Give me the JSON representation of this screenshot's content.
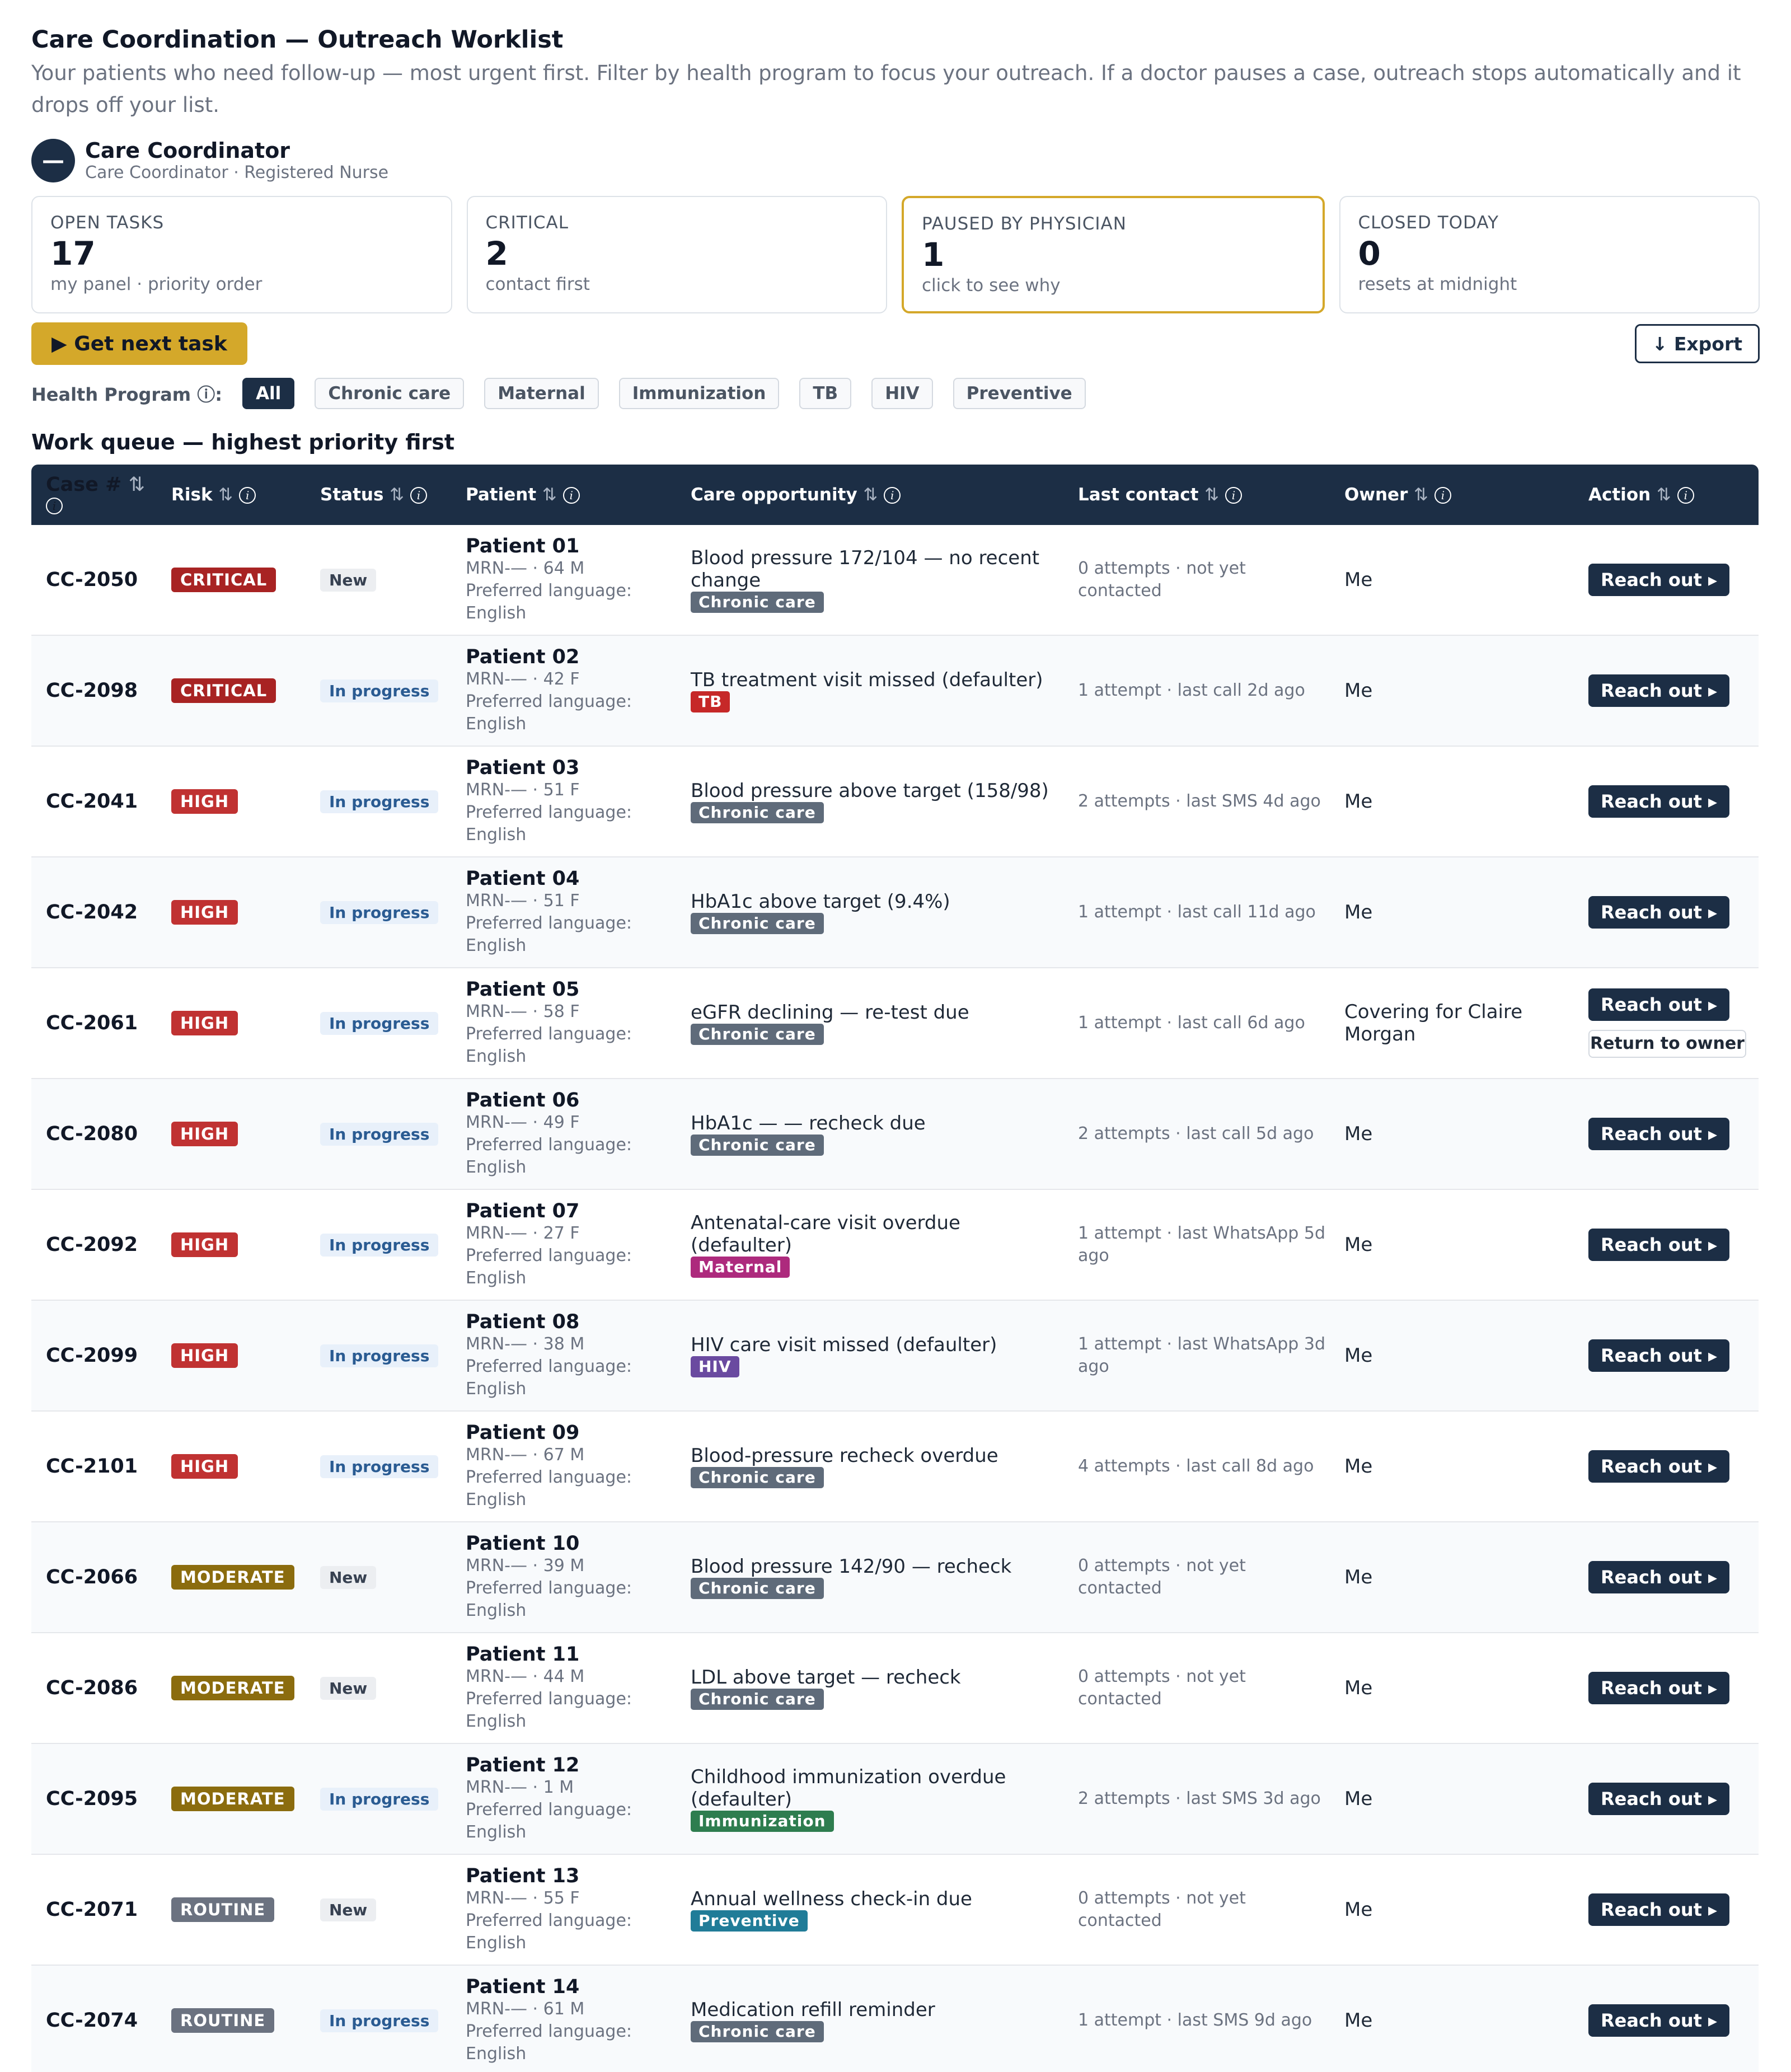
{
  "page": {
    "title": "Care Coordination — Outreach Worklist",
    "subtitle": "Your patients who need follow-up — most urgent first. Filter by health program to focus your outreach. If a doctor pauses a case, outreach stops automatically and it drops off your list."
  },
  "user": {
    "initial": "—",
    "name": "Care Coordinator",
    "role": "Care Coordinator · Registered Nurse"
  },
  "stats": [
    {
      "label": "OPEN TASKS",
      "value": "17",
      "note": "my panel · priority order"
    },
    {
      "label": "CRITICAL",
      "value": "2",
      "note": "contact first"
    },
    {
      "label": "PAUSED BY PHYSICIAN",
      "value": "1",
      "note": "click to see why"
    },
    {
      "label": "CLOSED TODAY",
      "value": "0",
      "note": "resets at midnight"
    }
  ],
  "actions": {
    "next_label": "▶ Get next task",
    "export_label": "↓ Export"
  },
  "filters": {
    "label": "Health Program ⓘ:",
    "chips": [
      "All",
      "Chronic care",
      "Maternal",
      "Immunization",
      "TB",
      "HIV",
      "Preventive"
    ],
    "active": "All"
  },
  "queue_title": "Work queue — highest priority first",
  "table": {
    "headers": [
      "Case #",
      "Risk",
      "Status",
      "Patient",
      "Care opportunity",
      "Last contact",
      "Owner",
      "Action"
    ],
    "sort_glyph": "⇅",
    "info_glyph": "i",
    "language_label": "Preferred language:",
    "reach_label": "Reach out ▸",
    "return_label": "Return to owner",
    "rows": [
      {
        "case": "CC-2050",
        "risk": "CRITICAL",
        "status": "New",
        "patient": "Patient 01",
        "meta": "MRN-— · 64 M",
        "language": "English",
        "opportunity": "Blood pressure 172/104 — no recent change",
        "program": "Chronic care",
        "last": "0 attempts · not yet contacted",
        "owner": "Me"
      },
      {
        "case": "CC-2098",
        "risk": "CRITICAL",
        "status": "In progress",
        "patient": "Patient 02",
        "meta": "MRN-— · 42 F",
        "language": "English",
        "opportunity": "TB treatment visit missed (defaulter)",
        "program": "TB",
        "last": "1 attempt · last call 2d ago",
        "owner": "Me"
      },
      {
        "case": "CC-2041",
        "risk": "HIGH",
        "status": "In progress",
        "patient": "Patient 03",
        "meta": "MRN-— · 51 F",
        "language": "English",
        "opportunity": "Blood pressure above target (158/98)",
        "program": "Chronic care",
        "last": "2 attempts · last SMS 4d ago",
        "owner": "Me"
      },
      {
        "case": "CC-2042",
        "risk": "HIGH",
        "status": "In progress",
        "patient": "Patient 04",
        "meta": "MRN-— · 51 F",
        "language": "English",
        "opportunity": "HbA1c above target (9.4%)",
        "program": "Chronic care",
        "last": "1 attempt · last call 11d ago",
        "owner": "Me"
      },
      {
        "case": "CC-2061",
        "risk": "HIGH",
        "status": "In progress",
        "patient": "Patient 05",
        "meta": "MRN-— · 58 F",
        "language": "English",
        "opportunity": "eGFR declining — re-test due",
        "program": "Chronic care",
        "last": "1 attempt · last call 6d ago",
        "owner": "Covering for Claire Morgan",
        "has_return": true
      },
      {
        "case": "CC-2080",
        "risk": "HIGH",
        "status": "In progress",
        "patient": "Patient 06",
        "meta": "MRN-— · 49 F",
        "language": "English",
        "opportunity": "HbA1c — — recheck due",
        "program": "Chronic care",
        "last": "2 attempts · last call 5d ago",
        "owner": "Me"
      },
      {
        "case": "CC-2092",
        "risk": "HIGH",
        "status": "In progress",
        "patient": "Patient 07",
        "meta": "MRN-— · 27 F",
        "language": "English",
        "opportunity": "Antenatal-care visit overdue (defaulter)",
        "program": "Maternal",
        "last": "1 attempt · last WhatsApp 5d ago",
        "owner": "Me"
      },
      {
        "case": "CC-2099",
        "risk": "HIGH",
        "status": "In progress",
        "patient": "Patient 08",
        "meta": "MRN-— · 38 M",
        "language": "English",
        "opportunity": "HIV care visit missed (defaulter)",
        "program": "HIV",
        "last": "1 attempt · last WhatsApp 3d ago",
        "owner": "Me"
      },
      {
        "case": "CC-2101",
        "risk": "HIGH",
        "status": "In progress",
        "patient": "Patient 09",
        "meta": "MRN-— · 67 M",
        "language": "English",
        "opportunity": "Blood-pressure recheck overdue",
        "program": "Chronic care",
        "last": "4 attempts · last call 8d ago",
        "owner": "Me"
      },
      {
        "case": "CC-2066",
        "risk": "MODERATE",
        "status": "New",
        "patient": "Patient 10",
        "meta": "MRN-— · 39 M",
        "language": "English",
        "opportunity": "Blood pressure 142/90 — recheck",
        "program": "Chronic care",
        "last": "0 attempts · not yet contacted",
        "owner": "Me"
      },
      {
        "case": "CC-2086",
        "risk": "MODERATE",
        "status": "New",
        "patient": "Patient 11",
        "meta": "MRN-— · 44 M",
        "language": "English",
        "opportunity": "LDL above target — recheck",
        "program": "Chronic care",
        "last": "0 attempts · not yet contacted",
        "owner": "Me"
      },
      {
        "case": "CC-2095",
        "risk": "MODERATE",
        "status": "In progress",
        "patient": "Patient 12",
        "meta": "MRN-— · 1 M",
        "language": "English",
        "opportunity": "Childhood immunization overdue (defaulter)",
        "program": "Immunization",
        "last": "2 attempts · last SMS 3d ago",
        "owner": "Me"
      },
      {
        "case": "CC-2071",
        "risk": "ROUTINE",
        "status": "New",
        "patient": "Patient 13",
        "meta": "MRN-— · 55 F",
        "language": "English",
        "opportunity": "Annual wellness check-in due",
        "program": "Preventive",
        "last": "0 attempts · not yet contacted",
        "owner": "Me"
      },
      {
        "case": "CC-2074",
        "risk": "ROUTINE",
        "status": "In progress",
        "patient": "Patient 14",
        "meta": "MRN-— · 61 M",
        "language": "English",
        "opportunity": "Medication refill reminder",
        "program": "Chronic care",
        "last": "1 attempt · last SMS 9d ago",
        "owner": "Me"
      }
    ]
  },
  "colors": {
    "navy": "#1c2e45",
    "accent": "#d4a82a",
    "critical": "#a82323",
    "high": "#c03232",
    "moderate": "#8b6c0e",
    "routine": "#6b7280",
    "program_chronic": "#5f6b7a",
    "program_tb": "#c62828",
    "program_maternal": "#ad2a7d",
    "program_hiv": "#6a4aa0",
    "program_immunization": "#2e7d4f",
    "program_preventive": "#207c98"
  }
}
